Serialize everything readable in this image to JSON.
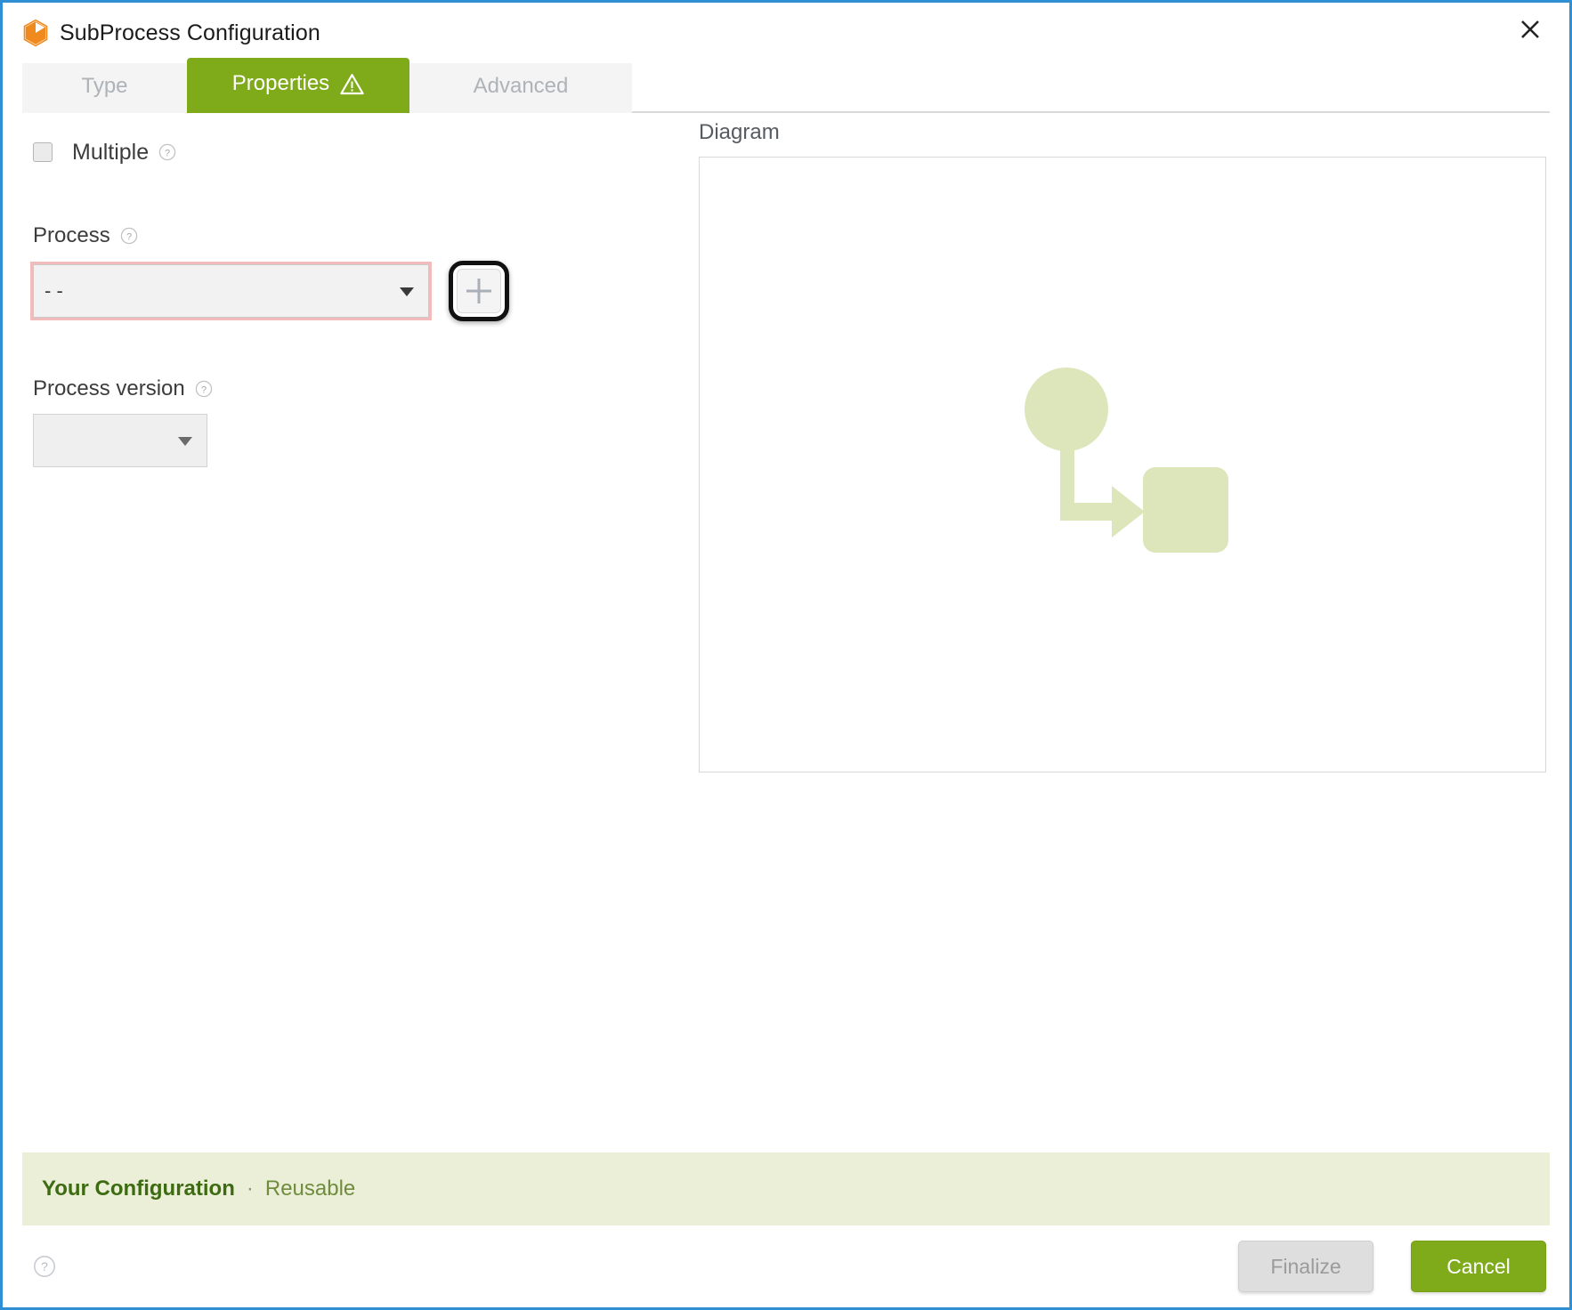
{
  "window": {
    "title": "SubProcess Configuration",
    "icon": "cube-icon",
    "close_icon": "close-icon",
    "border_color": "#2e8fd4"
  },
  "tabs": [
    {
      "label": "Type",
      "active": false,
      "warning": false,
      "name": "tab-type"
    },
    {
      "label": "Properties",
      "active": true,
      "warning": true,
      "warning_icon": "warning-triangle-icon",
      "name": "tab-properties"
    },
    {
      "label": "Advanced",
      "active": false,
      "warning": false,
      "name": "tab-advanced"
    }
  ],
  "form": {
    "multiple": {
      "label": "Multiple",
      "checked": false,
      "help_icon": "help-circle-icon"
    },
    "process": {
      "label": "Process",
      "help_icon": "help-circle-icon",
      "value": "- -",
      "invalid": true,
      "caret_icon": "chevron-down-icon",
      "add_button_icon": "plus-icon"
    },
    "process_version": {
      "label": "Process version",
      "help_icon": "help-circle-icon",
      "value": "",
      "caret_icon": "chevron-down-icon"
    }
  },
  "diagram": {
    "label": "Diagram",
    "shapes": [
      "start-event-circle",
      "sequence-flow-arrow",
      "task-rounded-rectangle"
    ],
    "fill_color": "#dde5bb"
  },
  "config_banner": {
    "title": "Your Configuration",
    "separator": "·",
    "subtitle": "Reusable",
    "background": "#ecefd7"
  },
  "footer": {
    "help_icon": "help-circle-icon",
    "finalize_label": "Finalize",
    "finalize_disabled": true,
    "cancel_label": "Cancel",
    "cancel_color": "#7fab1b"
  }
}
